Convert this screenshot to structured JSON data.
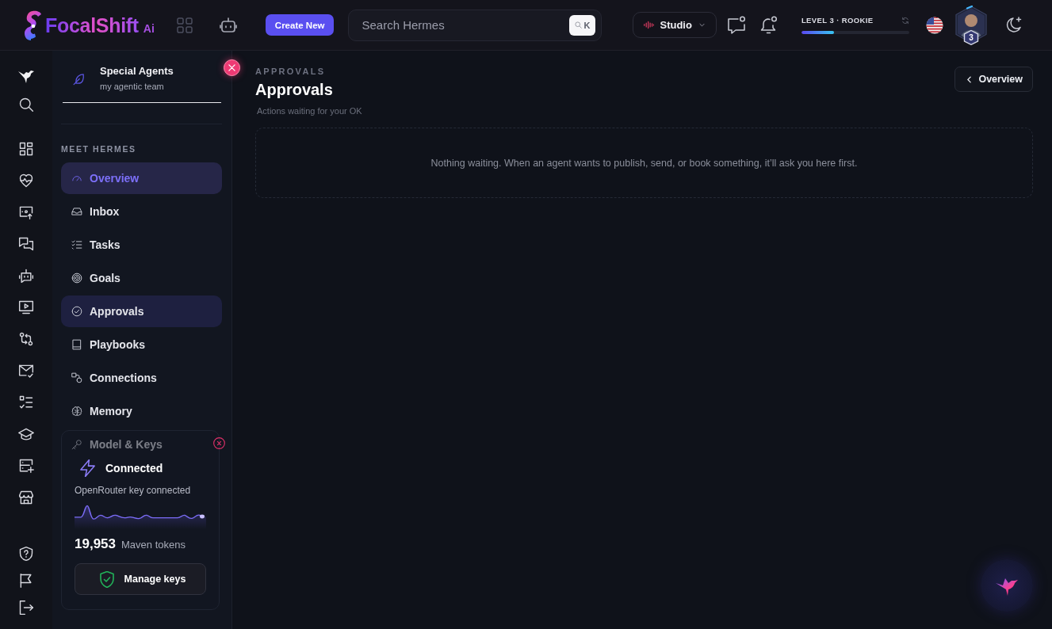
{
  "topbar": {
    "logo": {
      "name": "FocalShift",
      "suffix": "Ai"
    },
    "create_button": "Create New",
    "search": {
      "placeholder": "Search Hermes",
      "shortcut": "K"
    },
    "studio": {
      "label": "Studio"
    },
    "level": {
      "label": "LEVEL 3 · ROOKIE",
      "level": 0.3
    },
    "avatar": {
      "badge": "3"
    }
  },
  "sidebar": {
    "team": {
      "title": "Special Agents",
      "subtitle": "my agentic team"
    },
    "section": "MEET HERMES",
    "items": [
      {
        "label": "Overview",
        "selected": true,
        "hovered": false
      },
      {
        "label": "Inbox",
        "selected": false,
        "hovered": false
      },
      {
        "label": "Tasks",
        "selected": false,
        "hovered": false
      },
      {
        "label": "Goals",
        "selected": false,
        "hovered": false
      },
      {
        "label": "Approvals",
        "selected": false,
        "hovered": true
      },
      {
        "label": "Playbooks",
        "selected": false,
        "hovered": false
      },
      {
        "label": "Connections",
        "selected": false,
        "hovered": false
      },
      {
        "label": "Memory",
        "selected": false,
        "hovered": false
      },
      {
        "label": "Model & Keys",
        "selected": false,
        "hovered": false
      }
    ]
  },
  "connection_card": {
    "title": "Connected",
    "subtitle": "OpenRouter key connected",
    "count": "19,953",
    "count_label": "Maven tokens",
    "button": "Manage keys"
  },
  "main": {
    "eyebrow": "APPROVALS",
    "title": "Approvals",
    "subtitle": "Actions waiting for your OK",
    "back_button": "Overview",
    "empty_message": "Nothing waiting. When an agent wants to publish, send, or book something, it’ll ask you here first."
  }
}
